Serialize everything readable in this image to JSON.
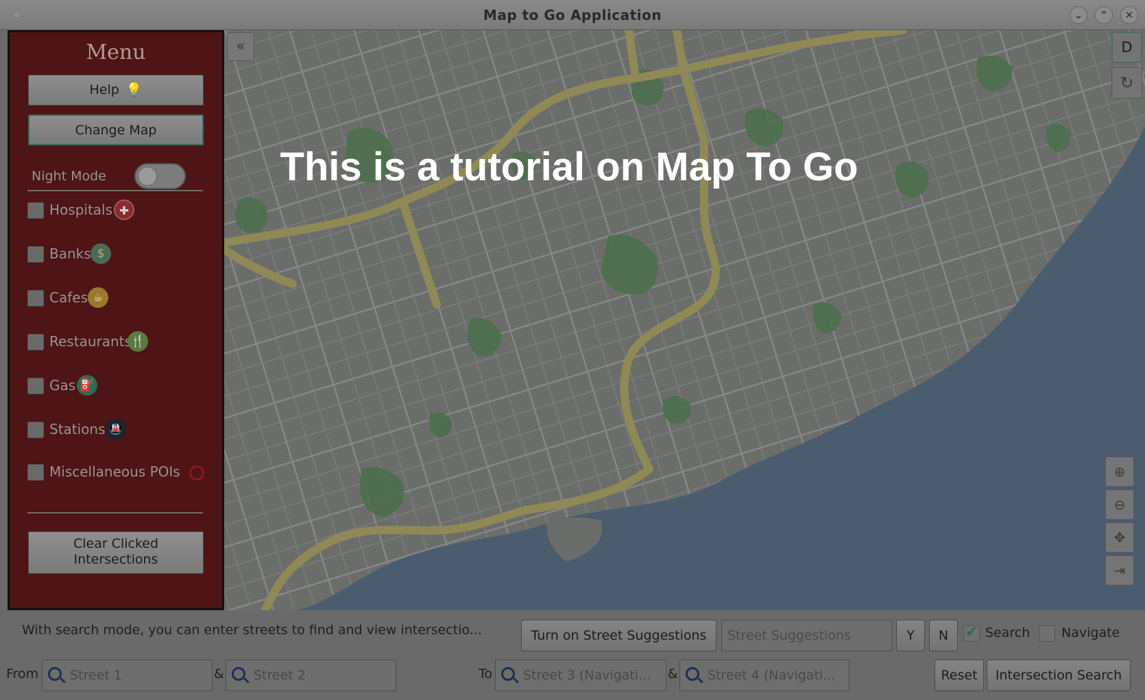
{
  "window": {
    "title": "Map to Go Application"
  },
  "menu": {
    "title": "Menu",
    "help_label": "Help",
    "change_map_label": "Change Map",
    "night_mode_label": "Night Mode",
    "clear_label_line1": "Clear Clicked",
    "clear_label_line2": "Intersections",
    "pois": [
      {
        "label": "Hospitals",
        "icon": "hospital-icon"
      },
      {
        "label": "Banks",
        "icon": "bank-icon"
      },
      {
        "label": "Cafes",
        "icon": "cafe-icon"
      },
      {
        "label": "Restaurants",
        "icon": "restaurant-icon"
      },
      {
        "label": "Gas",
        "icon": "gas-icon"
      },
      {
        "label": "Stations",
        "icon": "station-icon"
      },
      {
        "label": "Miscellaneous POIs",
        "icon": "misc-poi-icon"
      }
    ]
  },
  "map": {
    "tutorial_text": "This is a tutorial on Map To Go",
    "d_button": "D"
  },
  "bottom": {
    "instruction": "With search mode, you can enter streets to find and view intersectio...",
    "street_suggestions_button": "Turn on Street Suggestions",
    "street_suggestions_placeholder": "Street Suggestions",
    "yes_label": "Y",
    "no_label": "N",
    "search_label": "Search",
    "navigate_label": "Navigate",
    "search_checked": true,
    "navigate_checked": false,
    "from_label": "From",
    "amp1": "&",
    "to_label": "To",
    "amp2": "&",
    "street1_placeholder": "Street 1",
    "street2_placeholder": "Street 2",
    "street3_placeholder": "Street 3 (Navigati...",
    "street4_placeholder": "Street 4 (Navigati...",
    "reset_label": "Reset",
    "intersection_search_label": "Intersection Search"
  },
  "colors": {
    "menu_bg": "#4e1416",
    "highway": "#8f8a55",
    "water": "#4a5c6e",
    "park": "#4d6f4e"
  }
}
